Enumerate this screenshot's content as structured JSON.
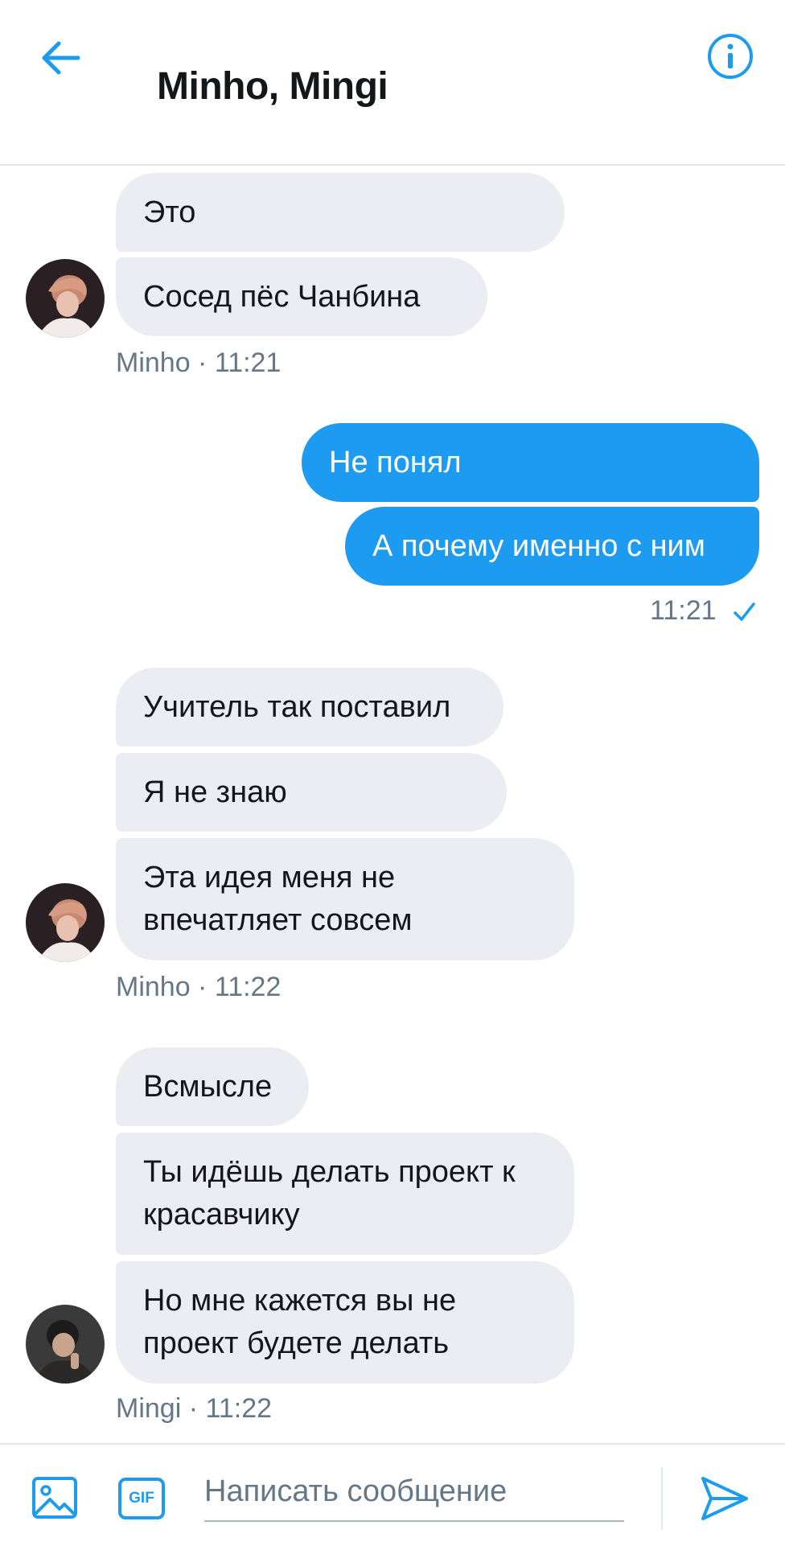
{
  "header": {
    "title": "Minho, Mingi"
  },
  "groups": [
    {
      "sender": "Minho",
      "time": "11:21",
      "meta": "Minho · 11:21",
      "messages": [
        "Это",
        "Сосед пёс Чанбина"
      ]
    },
    {
      "sender": "me",
      "time": "11:21",
      "messages": [
        "Не понял",
        "А почему именно с ним"
      ]
    },
    {
      "sender": "Minho",
      "time": "11:22",
      "meta": "Minho · 11:22",
      "messages": [
        "Учитель так поставил",
        "Я не знаю",
        "Эта идея меня не впечатляет совсем"
      ]
    },
    {
      "sender": "Mingi",
      "time": "11:22",
      "meta": "Mingi · 11:22",
      "messages": [
        "Всмысле",
        "Ты идёшь делать проект к красавчику",
        "Но мне кажется вы не проект будете делать"
      ]
    }
  ],
  "composer": {
    "placeholder": "Написать сообщение",
    "gif_label": "GIF"
  },
  "colors": {
    "accent": "#1d9bf0",
    "incoming_bubble": "#ebedf2",
    "meta_text": "#657786"
  },
  "icons": [
    "back-arrow-icon",
    "info-icon",
    "read-check-icon",
    "image-icon",
    "gif-icon",
    "send-icon"
  ]
}
